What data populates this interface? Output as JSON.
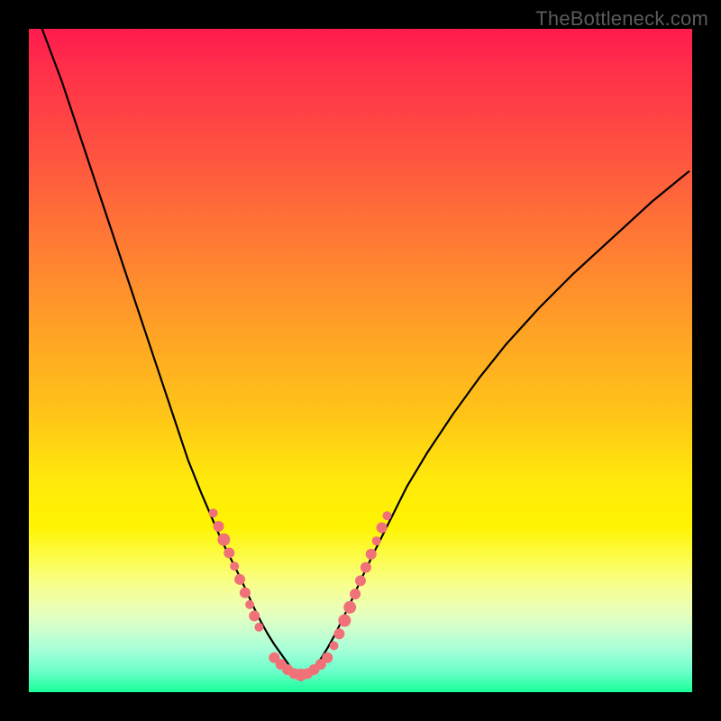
{
  "watermark": "TheBottleneck.com",
  "chart_data": {
    "type": "line",
    "title": "",
    "xlabel": "",
    "ylabel": "",
    "xlim": [
      0,
      100
    ],
    "ylim": [
      0,
      100
    ],
    "curves": [
      {
        "name": "left-branch",
        "x": [
          2,
          5,
          8,
          11,
          14,
          17,
          20,
          22,
          24,
          26,
          27.5,
          29,
          30.5,
          32,
          33,
          34,
          35,
          36,
          37,
          38,
          39,
          40,
          41
        ],
        "y": [
          100,
          92,
          83,
          74,
          65,
          56,
          47,
          41,
          35,
          30,
          26.5,
          23,
          20,
          17,
          14.8,
          12.6,
          10.6,
          8.8,
          7.2,
          5.8,
          4.4,
          3.0,
          1.8
        ]
      },
      {
        "name": "right-branch",
        "x": [
          41,
          42,
          43,
          44,
          45,
          46,
          47,
          48.5,
          50,
          52,
          54,
          57,
          60,
          64,
          68,
          72,
          77,
          82,
          88,
          94,
          99.5
        ],
        "y": [
          1.8,
          2.6,
          3.6,
          5.0,
          6.6,
          8.4,
          10.4,
          13.5,
          16.8,
          21,
          25,
          31,
          36,
          42,
          47.5,
          52.5,
          58,
          63,
          68.5,
          74,
          78.5
        ]
      }
    ],
    "marker_clusters": [
      {
        "branch": "left",
        "points": [
          {
            "x": 27.8,
            "y": 27.0,
            "r": 5
          },
          {
            "x": 28.6,
            "y": 25.0,
            "r": 6
          },
          {
            "x": 29.4,
            "y": 23.0,
            "r": 7
          },
          {
            "x": 30.2,
            "y": 21.0,
            "r": 6
          },
          {
            "x": 31.0,
            "y": 19.0,
            "r": 5
          },
          {
            "x": 31.8,
            "y": 17.0,
            "r": 6
          },
          {
            "x": 32.6,
            "y": 15.0,
            "r": 6
          },
          {
            "x": 33.3,
            "y": 13.2,
            "r": 5
          },
          {
            "x": 34.0,
            "y": 11.5,
            "r": 6
          },
          {
            "x": 34.7,
            "y": 9.8,
            "r": 5
          }
        ]
      },
      {
        "branch": "bottom",
        "points": [
          {
            "x": 37.0,
            "y": 5.2,
            "r": 6
          },
          {
            "x": 38.0,
            "y": 4.2,
            "r": 6
          },
          {
            "x": 39.0,
            "y": 3.4,
            "r": 6
          },
          {
            "x": 40.0,
            "y": 2.8,
            "r": 6
          },
          {
            "x": 41.0,
            "y": 2.6,
            "r": 7
          },
          {
            "x": 42.0,
            "y": 2.8,
            "r": 6
          },
          {
            "x": 43.0,
            "y": 3.4,
            "r": 6
          },
          {
            "x": 44.0,
            "y": 4.2,
            "r": 6
          },
          {
            "x": 45.0,
            "y": 5.2,
            "r": 6
          }
        ]
      },
      {
        "branch": "right",
        "points": [
          {
            "x": 46.0,
            "y": 7.0,
            "r": 5
          },
          {
            "x": 46.8,
            "y": 8.8,
            "r": 6
          },
          {
            "x": 47.6,
            "y": 10.8,
            "r": 7
          },
          {
            "x": 48.4,
            "y": 12.8,
            "r": 7
          },
          {
            "x": 49.2,
            "y": 14.8,
            "r": 6
          },
          {
            "x": 50.0,
            "y": 16.8,
            "r": 6
          },
          {
            "x": 50.8,
            "y": 18.8,
            "r": 6
          },
          {
            "x": 51.6,
            "y": 20.8,
            "r": 6
          },
          {
            "x": 52.4,
            "y": 22.8,
            "r": 5
          },
          {
            "x": 53.2,
            "y": 24.8,
            "r": 6
          },
          {
            "x": 54.0,
            "y": 26.6,
            "r": 5
          }
        ]
      }
    ]
  }
}
